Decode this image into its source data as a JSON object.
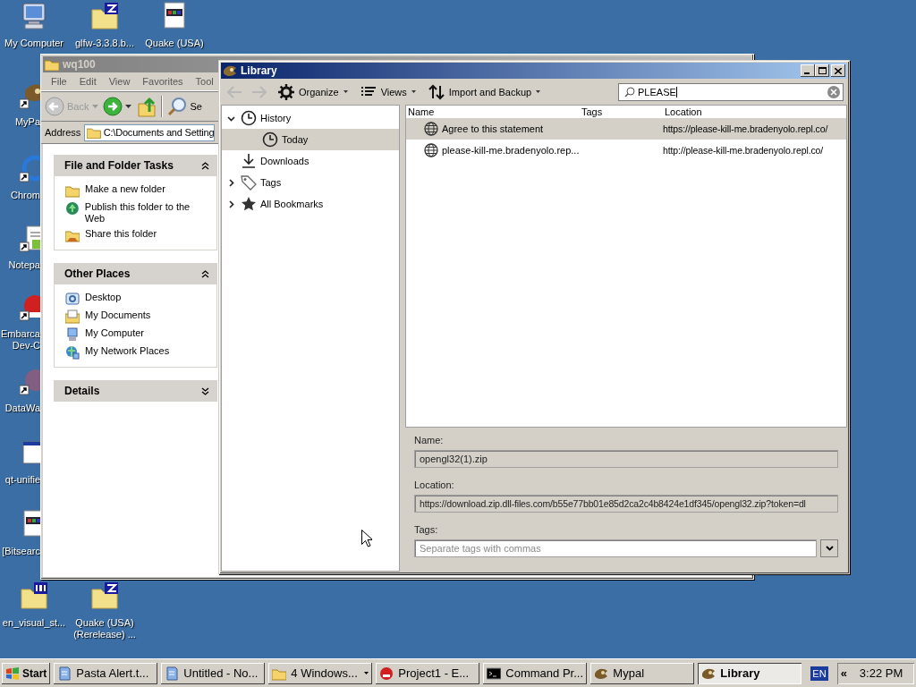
{
  "desktop_icons": [
    {
      "label": "My Computer",
      "kind": "computer",
      "shortcut": false
    },
    {
      "label": "glfw-3.3.8.b...",
      "kind": "archive",
      "shortcut": false
    },
    {
      "label": "Quake (USA)",
      "kind": "app-window",
      "shortcut": false
    },
    {
      "label": "MyPa",
      "kind": "mypal",
      "shortcut": true
    },
    {
      "label": "Chrom",
      "kind": "chrome",
      "shortcut": true
    },
    {
      "label": "Notepa",
      "kind": "notepad",
      "shortcut": true
    },
    {
      "label": "Embarca Dev-C",
      "kind": "devcpp",
      "shortcut": true
    },
    {
      "label": "DataWa",
      "kind": "datawarrior",
      "shortcut": true
    },
    {
      "label": "qt-unifie",
      "kind": "window",
      "shortcut": false
    },
    {
      "label": "[Bitsearc",
      "kind": "app-window",
      "shortcut": false
    },
    {
      "label": "en_visual_st...",
      "kind": "iso",
      "shortcut": false
    },
    {
      "label": "Quake (USA) (Rerelease) ...",
      "kind": "archive",
      "shortcut": false
    }
  ],
  "explorer_window": {
    "title": "wq100",
    "active": false,
    "menu": [
      "File",
      "Edit",
      "View",
      "Favorites",
      "Tool"
    ],
    "toolbar": {
      "back": "Back",
      "search": "Se"
    },
    "address": {
      "label": "Address",
      "value": "C:\\Documents and Setting"
    },
    "task_panes": [
      {
        "title": "File and Folder Tasks",
        "expanded": true,
        "items": [
          {
            "label": "Make a new folder",
            "kind": "new-folder"
          },
          {
            "label": "Publish this folder to the Web",
            "kind": "publish"
          },
          {
            "label": "Share this folder",
            "kind": "share"
          }
        ]
      },
      {
        "title": "Other Places",
        "expanded": true,
        "items": [
          {
            "label": "Desktop",
            "kind": "desktop"
          },
          {
            "label": "My Documents",
            "kind": "documents"
          },
          {
            "label": "My Computer",
            "kind": "computer"
          },
          {
            "label": "My Network Places",
            "kind": "network"
          }
        ]
      },
      {
        "title": "Details",
        "expanded": false
      }
    ]
  },
  "library": {
    "title": "Library",
    "active": true,
    "nav": [
      {
        "kind": "back",
        "disabled": true
      },
      {
        "kind": "forward",
        "disabled": true
      }
    ],
    "menus": [
      {
        "label": "Organize",
        "kind": "gear"
      },
      {
        "label": "Views",
        "kind": "list"
      },
      {
        "label": "Import and Backup",
        "kind": "updown"
      }
    ],
    "search": {
      "value": "PLEASE"
    },
    "tree": [
      {
        "label": "History",
        "kind": "history",
        "expanded": true,
        "selected": false,
        "children": [
          {
            "label": "Today",
            "kind": "history",
            "selected": true
          }
        ]
      },
      {
        "label": "Downloads",
        "kind": "downloads",
        "selected": false
      },
      {
        "label": "Tags",
        "kind": "tags",
        "expanded": false,
        "selected": false
      },
      {
        "label": "All Bookmarks",
        "kind": "bookmarks",
        "expanded": false,
        "selected": false
      }
    ],
    "columns": [
      "Name",
      "Tags",
      "Location"
    ],
    "rows": [
      {
        "name": "Agree to this statement",
        "location": "https://please-kill-me.bradenyolo.repl.co/",
        "selected": true
      },
      {
        "name": "please-kill-me.bradenyolo.rep...",
        "location": "http://please-kill-me.bradenyolo.repl.co/",
        "selected": false
      }
    ],
    "details": {
      "name": {
        "label": "Name:",
        "value": "opengl32(1).zip"
      },
      "location": {
        "label": "Location:",
        "value": "https://download.zip.dll-files.com/b55e77bb01e85d2ca2c4b8424e1df345/opengl32.zip?token=dl"
      },
      "tags": {
        "label": "Tags:",
        "placeholder": "Separate tags with commas"
      }
    }
  },
  "taskbar": {
    "start": "Start",
    "tasks": [
      {
        "label": "Pasta Alert.t...",
        "kind": "notepad",
        "selected": false
      },
      {
        "label": "Untitled - No...",
        "kind": "notepad",
        "selected": false
      },
      {
        "label": "4 Windows...",
        "kind": "folder",
        "selected": false
      },
      {
        "label": "Project1 - E...",
        "kind": "devcpp",
        "selected": false
      },
      {
        "label": "Command Pr...",
        "kind": "console",
        "selected": false
      },
      {
        "label": "Mypal",
        "kind": "mypal",
        "selected": false
      },
      {
        "label": "Library",
        "kind": "mypal",
        "selected": true
      }
    ],
    "language": "EN",
    "tray_toggle": "«",
    "clock": "3:22 PM"
  }
}
